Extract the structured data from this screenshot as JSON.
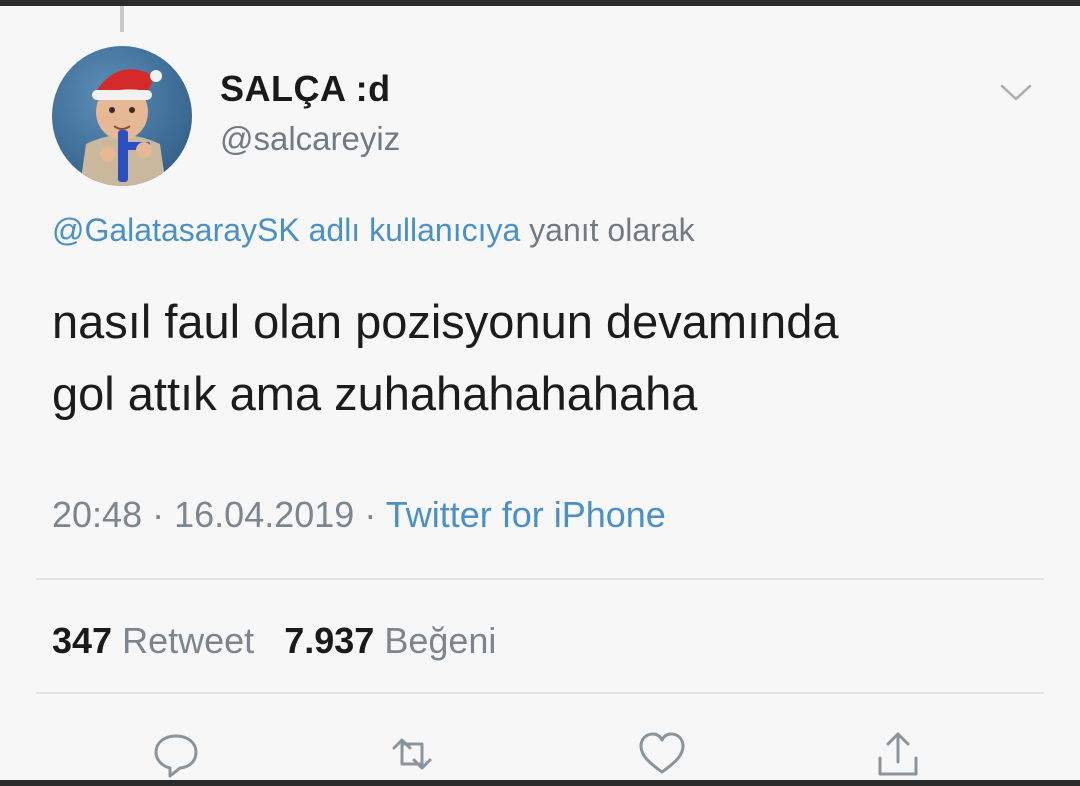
{
  "user": {
    "display_name": "SALÇA :d",
    "username": "@salcareyiz"
  },
  "reply": {
    "handle": "@GalatasaraySK adlı kullanıcıya",
    "suffix": "yanıt olarak"
  },
  "tweet": {
    "line1": "nasıl faul olan pozisyonun devamında",
    "line2": "gol attık ama zuhahahahahaha"
  },
  "meta": {
    "time": "20:48",
    "date": "16.04.2019",
    "source": "Twitter for iPhone",
    "separator": "·"
  },
  "stats": {
    "retweet_count": "347",
    "retweet_label": "Retweet",
    "like_count": "7.937",
    "like_label": "Beğeni"
  },
  "icons": {
    "menu": "chevron-down-icon",
    "reply": "reply-icon",
    "retweet": "retweet-icon",
    "like": "heart-icon",
    "share": "share-icon"
  },
  "colors": {
    "link": "#4a90c8",
    "muted": "#7c868e",
    "text": "#1c1c1c",
    "background": "#f7f7f7"
  }
}
